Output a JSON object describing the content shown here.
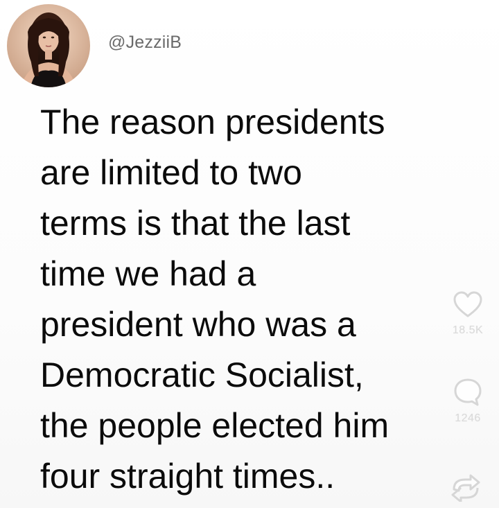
{
  "profile": {
    "handle": "@JezziiB"
  },
  "post": {
    "lines": [
      "The reason presidents",
      "are limited to two",
      "terms is that the last",
      "time we had a",
      "president who was a",
      "Democratic Socialist,",
      "the people elected him",
      "four straight times.."
    ]
  },
  "actions": {
    "like_count": "18.5K",
    "comment_count": "1246",
    "like_icon": "heart-icon",
    "comment_icon": "comment-icon",
    "share_icon": "share-icon"
  },
  "colors": {
    "text": "#0b0b0b",
    "handle": "#6a6a6a",
    "overlay_icons": "#dadada"
  }
}
